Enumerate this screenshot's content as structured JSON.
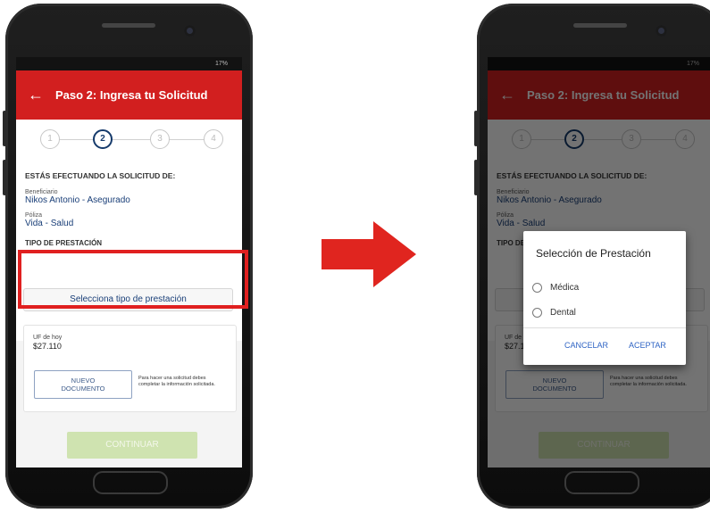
{
  "screen": {
    "statusbar": "17%",
    "appbar": {
      "back_glyph": "←",
      "title": "Paso 2: Ingresa tu Solicitud"
    },
    "stepper": [
      "1",
      "2",
      "3",
      "4"
    ],
    "summary": {
      "heading": "ESTÁS EFECTUANDO LA SOLICITUD DE:",
      "beneficiario_label": "Beneficiario",
      "beneficiario_value": "Nikos Antonio - Asegurado",
      "poliza_label": "Póliza",
      "poliza_value": "Vida - Salud",
      "prestacion_label": "TIPO DE PRESTACIÓN",
      "prestacion_button": "Selecciona tipo de prestación"
    },
    "uf": {
      "label": "UF de hoy",
      "value": "$27.110",
      "nuevo_line1": "NUEVO",
      "nuevo_line2": "DOCUMENTO",
      "note": "Para hacer una solicitud debes completar la información solicitada."
    },
    "continuar": "CONTINUAR"
  },
  "dialog": {
    "title": "Selección de Prestación",
    "options": [
      "Médica",
      "Dental"
    ],
    "cancel": "CANCELAR",
    "accept": "ACEPTAR"
  },
  "colors": {
    "brand_red": "#d21f1f",
    "navy": "#1a3f78",
    "highlight_red": "#e02020",
    "arrow_red": "#e0251f"
  }
}
